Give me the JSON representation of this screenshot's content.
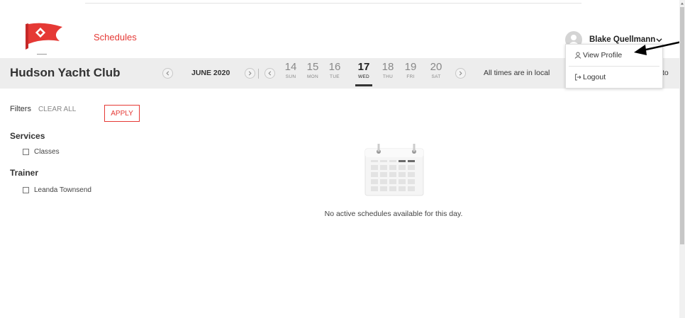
{
  "header": {
    "nav_schedules": "Schedules",
    "user_name": "Blake Quellmann"
  },
  "user_dropdown": {
    "items": [
      {
        "label": "View Profile",
        "icon": "user-outline-icon"
      },
      {
        "label": "Logout",
        "icon": "logout-icon"
      }
    ]
  },
  "subbar": {
    "club_name": "Hudson Yacht Club",
    "month_label": "JUNE 2020",
    "days": [
      {
        "num": "14",
        "dow": "SUN"
      },
      {
        "num": "15",
        "dow": "MON"
      },
      {
        "num": "16",
        "dow": "TUE"
      },
      {
        "num": "17",
        "dow": "WED",
        "active": true
      },
      {
        "num": "18",
        "dow": "THU"
      },
      {
        "num": "19",
        "dow": "FRI"
      },
      {
        "num": "20",
        "dow": "SAT"
      }
    ],
    "tz_note": "All times are in local",
    "tz_tail": "to"
  },
  "filters": {
    "label": "Filters",
    "clear_all": "CLEAR ALL",
    "apply": "APPLY",
    "sections": [
      {
        "title": "Services",
        "options": [
          "Classes"
        ]
      },
      {
        "title": "Trainer",
        "options": [
          "Leanda Townsend"
        ]
      }
    ]
  },
  "main": {
    "empty_message": "No active schedules available for this day."
  },
  "colors": {
    "accent": "#e53935",
    "subbar_bg": "#ededed"
  }
}
